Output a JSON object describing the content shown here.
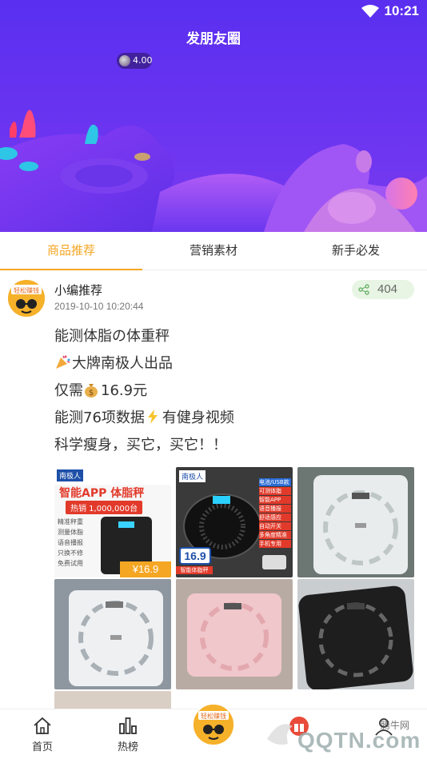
{
  "status": {
    "time": "10:21"
  },
  "header": {
    "title": "发朋友圈",
    "coins": "4.00"
  },
  "tabs": [
    {
      "label": "商品推荐",
      "active": true
    },
    {
      "label": "营销素材",
      "active": false
    },
    {
      "label": "新手必发",
      "active": false
    }
  ],
  "post": {
    "author": "小编推荐",
    "avatar_text": "轻松赚钱",
    "time": "2019-10-10 10:20:44",
    "share_count": "404",
    "lines": [
      "能测体脂の体重秤",
      "大牌南极人出品",
      "仅需",
      "16.9元",
      "能测76项数据",
      "有健身视频",
      "科学瘦身，买它，买它！！"
    ],
    "images": {
      "img1_brand": "南极人",
      "img1_title": "智能APP 体脂秤",
      "img1_sales": "热销 1,000,000台",
      "img1_price": "¥16.9",
      "img1_features": [
        "精准秤重",
        "测量体脂",
        "语音播报",
        "只换不修",
        "免费试用"
      ],
      "img2_brand": "南极人",
      "img2_price": "16.9",
      "img2_tag": "智能体脂秤",
      "img2_features": [
        "电池/USB款",
        "可测体脂",
        "智能APP",
        "语音播报",
        "舒适感应",
        "自动开关",
        "多角度精准",
        "手机专用"
      ]
    }
  },
  "bottom_nav": [
    {
      "label": "首页",
      "icon": "home-icon"
    },
    {
      "label": "热榜",
      "icon": "chart-bars-icon"
    },
    {
      "label": "",
      "icon": "center-avatar"
    },
    {
      "label": "",
      "icon": "gift-icon"
    },
    {
      "label": "",
      "icon": "user-icon"
    }
  ],
  "watermark": {
    "text1": "腾牛网",
    "text2": "QQTN.com"
  },
  "colors": {
    "primary": "#f5a623",
    "banner": "#5a2ff0"
  }
}
